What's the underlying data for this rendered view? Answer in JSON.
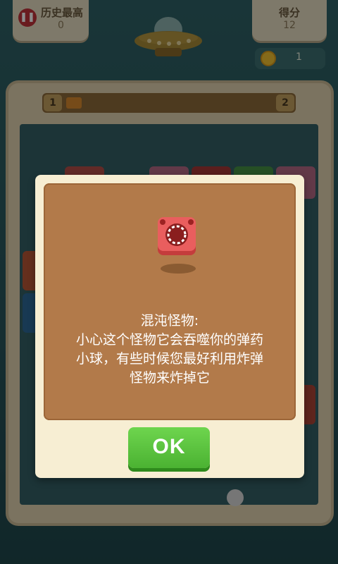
{
  "hud": {
    "best_label": "历史最高",
    "best_value": "0",
    "score_label": "得分",
    "score_value": "12",
    "coins": "1",
    "pause_icon": "pause-icon"
  },
  "level": {
    "current": "1",
    "next": "2"
  },
  "dialog": {
    "title": "混沌怪物:",
    "lines": [
      "小心这个怪物它会吞噬你的弹药",
      "小球，有些时候您最好利用炸弹",
      "怪物来炸掉它"
    ],
    "ok_label": "OK"
  },
  "colors": {
    "panel_brown": "#b27a4a",
    "ok_green": "#5cc43e",
    "monster_red": "#e85a5a"
  }
}
